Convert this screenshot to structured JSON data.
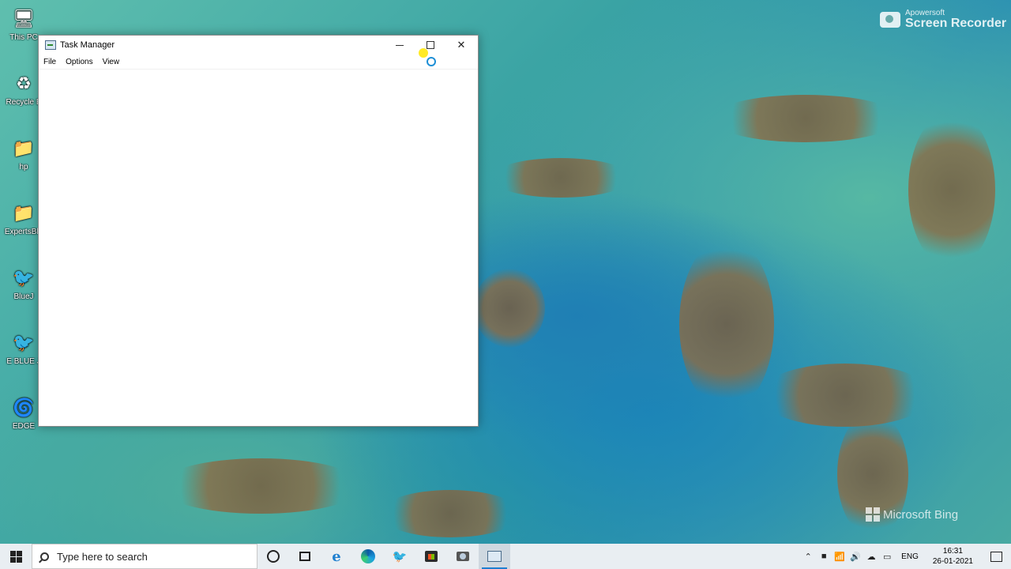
{
  "desktop": {
    "icons": [
      {
        "label": "This PC",
        "icon": "computer-icon"
      },
      {
        "label": "Recycle B",
        "icon": "recycle-bin-icon"
      },
      {
        "label": "hp",
        "icon": "user-folder-icon"
      },
      {
        "label": "ExpertsBlu",
        "icon": "folder-icon"
      },
      {
        "label": "BlueJ",
        "icon": "bluej-icon"
      },
      {
        "label": "E BLUE J",
        "icon": "bluej-icon"
      },
      {
        "label": "EDGE",
        "icon": "edge-icon"
      }
    ],
    "watermark_recorder_brand": "Apowersoft",
    "watermark_recorder_name": "Screen Recorder",
    "watermark_bing": "Microsoft Bing"
  },
  "window": {
    "title": "Task Manager",
    "menu": [
      "File",
      "Options",
      "View"
    ],
    "controls": {
      "minimize": "minimize-icon",
      "maximize": "maximize-icon",
      "close": "close-icon"
    }
  },
  "taskbar": {
    "search_placeholder": "Type here to search",
    "language": "ENG",
    "time": "16:31",
    "date": "26-01-2021",
    "background_color": "#e9eef2"
  }
}
